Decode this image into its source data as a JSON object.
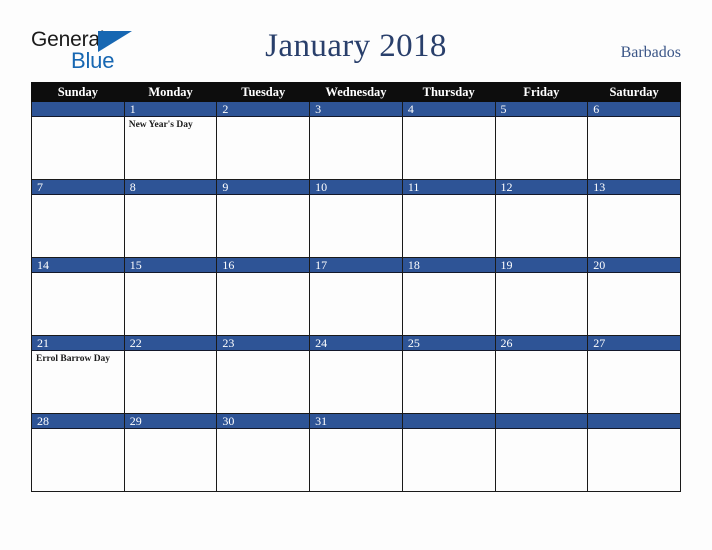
{
  "brand": {
    "logo_text_top": "General",
    "logo_text_bottom": "Blue",
    "logo_dark_color": "#1b1b1b",
    "logo_blue_color": "#1767b2"
  },
  "header": {
    "title": "January 2018",
    "country": "Barbados",
    "title_color": "#293f6b",
    "country_color": "#3b5687"
  },
  "calendar": {
    "header_bg": "#0d0d0d",
    "header_text_color": "#ffffff",
    "date_band_color": "#2e5496",
    "date_text_color": "#ffffff",
    "cell_bg": "#fdfdfd",
    "grid_color": "#1a1a1a",
    "weekdays": [
      "Sunday",
      "Monday",
      "Tuesday",
      "Wednesday",
      "Thursday",
      "Friday",
      "Saturday"
    ],
    "weeks": [
      [
        {
          "date": "",
          "events": []
        },
        {
          "date": "1",
          "events": [
            "New Year's Day"
          ]
        },
        {
          "date": "2",
          "events": []
        },
        {
          "date": "3",
          "events": []
        },
        {
          "date": "4",
          "events": []
        },
        {
          "date": "5",
          "events": []
        },
        {
          "date": "6",
          "events": []
        }
      ],
      [
        {
          "date": "7",
          "events": []
        },
        {
          "date": "8",
          "events": []
        },
        {
          "date": "9",
          "events": []
        },
        {
          "date": "10",
          "events": []
        },
        {
          "date": "11",
          "events": []
        },
        {
          "date": "12",
          "events": []
        },
        {
          "date": "13",
          "events": []
        }
      ],
      [
        {
          "date": "14",
          "events": []
        },
        {
          "date": "15",
          "events": []
        },
        {
          "date": "16",
          "events": []
        },
        {
          "date": "17",
          "events": []
        },
        {
          "date": "18",
          "events": []
        },
        {
          "date": "19",
          "events": []
        },
        {
          "date": "20",
          "events": []
        }
      ],
      [
        {
          "date": "21",
          "events": [
            "Errol Barrow Day"
          ]
        },
        {
          "date": "22",
          "events": []
        },
        {
          "date": "23",
          "events": []
        },
        {
          "date": "24",
          "events": []
        },
        {
          "date": "25",
          "events": []
        },
        {
          "date": "26",
          "events": []
        },
        {
          "date": "27",
          "events": []
        }
      ],
      [
        {
          "date": "28",
          "events": []
        },
        {
          "date": "29",
          "events": []
        },
        {
          "date": "30",
          "events": []
        },
        {
          "date": "31",
          "events": []
        },
        {
          "date": "",
          "events": []
        },
        {
          "date": "",
          "events": []
        },
        {
          "date": "",
          "events": []
        }
      ]
    ]
  }
}
